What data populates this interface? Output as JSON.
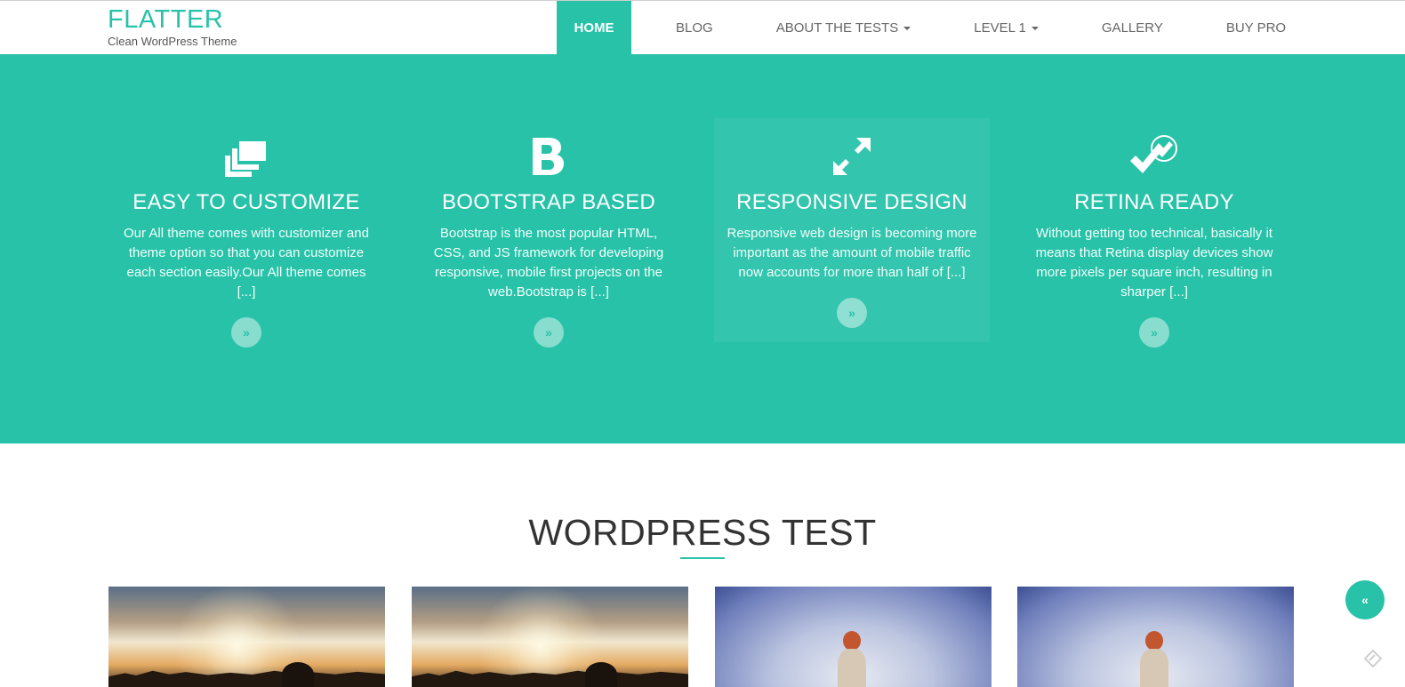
{
  "brand": {
    "title": "FLATTER",
    "tagline": "Clean WordPress Theme"
  },
  "nav": {
    "home": "HOME",
    "blog": "BLOG",
    "about": "ABOUT THE TESTS",
    "level1": "LEVEL 1",
    "gallery": "GALLERY",
    "buypro": "BUY PRO"
  },
  "features": [
    {
      "icon": "layers-icon",
      "title": "EASY TO CUSTOMIZE",
      "text": "Our All theme comes with customizer and theme option so that you can customize each section easily.Our All theme comes [...]",
      "button": "»"
    },
    {
      "icon": "bootstrap-icon",
      "title": "BOOTSTRAP BASED",
      "text": "Bootstrap is the most popular HTML, CSS, and JS framework for developing responsive, mobile first projects on the web.Bootstrap is [...]",
      "button": "»"
    },
    {
      "icon": "expand-arrows-icon",
      "title": "RESPONSIVE DESIGN",
      "text": "Responsive web design is becoming more important as the amount of mobile traffic now accounts for more than half of [...]",
      "button": "»"
    },
    {
      "icon": "check-pen-icon",
      "title": "RETINA READY",
      "text": "Without getting too technical, basically it means that Retina display devices show more pixels per square inch, resulting in sharper [...]",
      "button": "»"
    }
  ],
  "section": {
    "title": "WORDPRESS TEST"
  },
  "totop": {
    "label": "«"
  },
  "colors": {
    "accent": "#27c2a8",
    "text": "#333333"
  }
}
